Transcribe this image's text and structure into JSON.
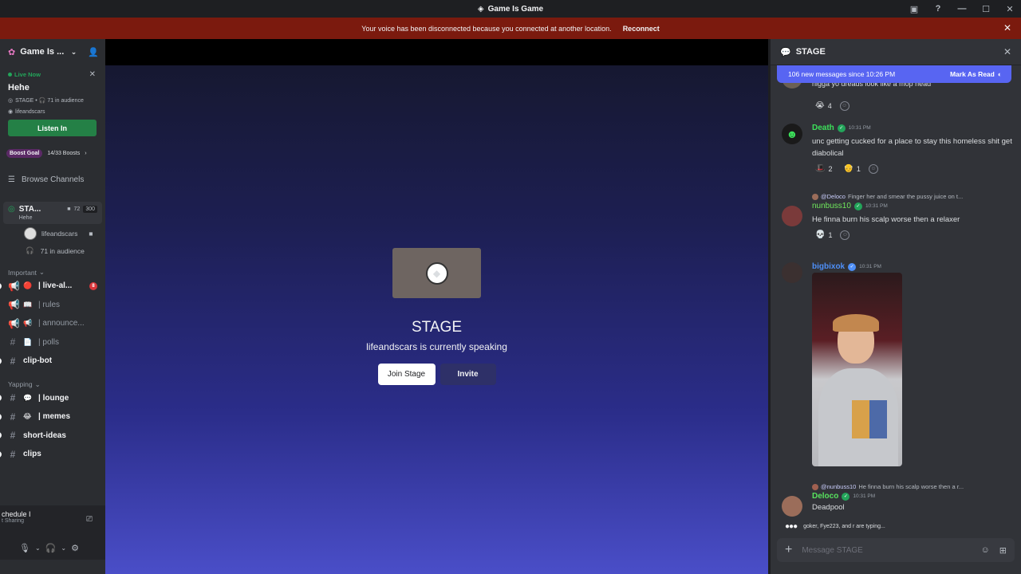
{
  "window": {
    "title": "Game Is Game"
  },
  "banner": {
    "message": "Your voice has been disconnected because you connected at another location.",
    "action": "Reconnect"
  },
  "server": {
    "name": "Game Is ..."
  },
  "live": {
    "status": "Live Now",
    "title": "Hehe",
    "meta": "STAGE • 🎧 71 in audience",
    "host": "lifeandscars",
    "listen_label": "Listen In"
  },
  "boost": {
    "label": "Boost Goal",
    "progress": "14/33 Boosts"
  },
  "browse_label": "Browse Channels",
  "stage_channel": {
    "name": "STA...",
    "topic": "Hehe",
    "viewers": "72",
    "capacity": "300"
  },
  "voice_user": "lifeandscars",
  "audience_label": "71 in audience",
  "categories": {
    "important": "Important",
    "yapping": "Yapping"
  },
  "channels_important": [
    {
      "emoji": "🔴",
      "label": "| live-al...",
      "badge": "8"
    },
    {
      "emoji": "📖",
      "label": "| rules"
    },
    {
      "emoji": "📢",
      "label": "| announce..."
    },
    {
      "emoji": "📄",
      "label": "| polls"
    },
    {
      "emoji": "",
      "label": "clip-bot"
    }
  ],
  "channels_yapping": [
    {
      "emoji": "💬",
      "label": "| lounge"
    },
    {
      "emoji": "😂",
      "label": "| memes"
    },
    {
      "emoji": "",
      "label": "short-ideas"
    },
    {
      "emoji": "",
      "label": "clips"
    }
  ],
  "voice_panel": {
    "title": "chedule I",
    "sub": "t Sharing"
  },
  "stage": {
    "title": "STAGE",
    "subtitle": "lifeandscars is currently speaking",
    "join_label": "Join Stage",
    "invite_label": "Invite"
  },
  "chat": {
    "title": "STAGE",
    "new_messages": "106 new messages since 10:26 PM",
    "mark_read": "Mark As Read",
    "top_fragment": "nigga yo dreads look like a mop head",
    "top_reaction": "4",
    "messages": [
      {
        "name": "Death",
        "time": "10:31 PM",
        "content": "unc getting cucked for a place to stay this homeless shit get diabolical",
        "reactions": [
          "2",
          "1"
        ]
      },
      {
        "reply_to": "@Deloco",
        "reply_text": "Finger her and smear the pussy juice on t...",
        "name": "nunbuss10",
        "time": "10:31 PM",
        "content": "He finna burn his scalp worse then a relaxer",
        "reactions": [
          "1"
        ]
      },
      {
        "name": "bigbixok",
        "time": "10:31 PM"
      },
      {
        "reply_to": "@nunbuss10",
        "reply_text": "He finna burn his scalp worse then a r...",
        "name": "Deloco",
        "time": "10:31 PM",
        "content": "Deadpool"
      }
    ],
    "typing": "goker, Fye223, and r are typing...",
    "composer_placeholder": "Message STAGE"
  },
  "colors": {
    "accent": "#5865f2",
    "banner": "#7b1a0e",
    "listen": "#248046",
    "death_name": "#3ce05a",
    "nunbuss_name": "#6fe85c",
    "bigbixok_name": "#4e8ff7",
    "deloco_name": "#58e35e"
  }
}
